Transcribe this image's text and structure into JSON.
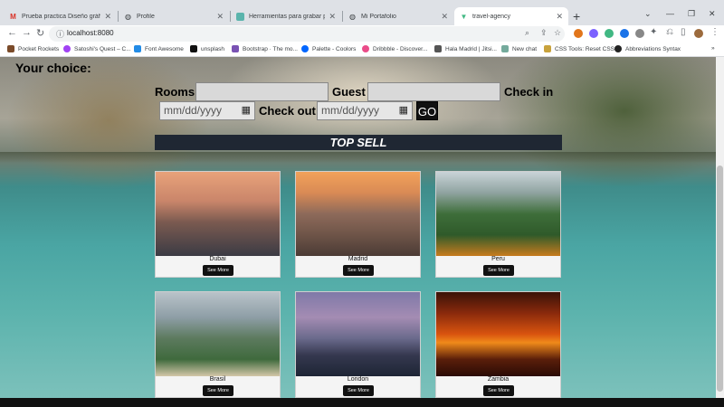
{
  "browser": {
    "tabs": [
      {
        "title": "Prueba practica Diseño gráfico y",
        "icon": "gmail-icon"
      },
      {
        "title": "Profile",
        "icon": "globe-icon"
      },
      {
        "title": "Herramientas para grabar pantall",
        "icon": "page-icon"
      },
      {
        "title": "Mi Portafolio",
        "icon": "globe-icon"
      },
      {
        "title": "travel-agency",
        "icon": "vue-icon"
      }
    ],
    "address": "localhost:8080",
    "bookmarks": [
      {
        "label": "Pocket Rockets",
        "color": "#7b4b2a"
      },
      {
        "label": "Satoshi's Quest – C...",
        "color": "#a142f4"
      },
      {
        "label": "Font Awesome",
        "color": "#228be6"
      },
      {
        "label": "unsplash",
        "color": "#111111"
      },
      {
        "label": "Bootstrap · The mo...",
        "color": "#7952b3"
      },
      {
        "label": "Palette - Coolors",
        "color": "#0066ff"
      },
      {
        "label": "Dribbble - Discover...",
        "color": "#ea4c89"
      },
      {
        "label": "Hala Madrid | Jitsi...",
        "color": "#555555"
      },
      {
        "label": "New chat",
        "color": "#74aa9c"
      },
      {
        "label": "CSS Tools: Reset CSS",
        "color": "#c8a23c"
      },
      {
        "label": "Abbreviations Syntax",
        "color": "#222222"
      }
    ]
  },
  "form": {
    "heading": "Your choice:",
    "rooms_label": "Rooms",
    "guest_label": "Guest",
    "checkin_label": "Check in",
    "checkout_label": "Check out",
    "checkin_placeholder": "mm/dd/yyyy",
    "checkout_placeholder": "mm/dd/yyyy",
    "go_label": "GO"
  },
  "section_title": "TOP SELL",
  "destinations": [
    {
      "name": "Dubai",
      "button": "See More"
    },
    {
      "name": "Madrid",
      "button": "See More"
    },
    {
      "name": "Peru",
      "button": "See More"
    },
    {
      "name": "Brasil",
      "button": "See More"
    },
    {
      "name": "London",
      "button": "See More"
    },
    {
      "name": "Zambia",
      "button": "See More"
    }
  ]
}
